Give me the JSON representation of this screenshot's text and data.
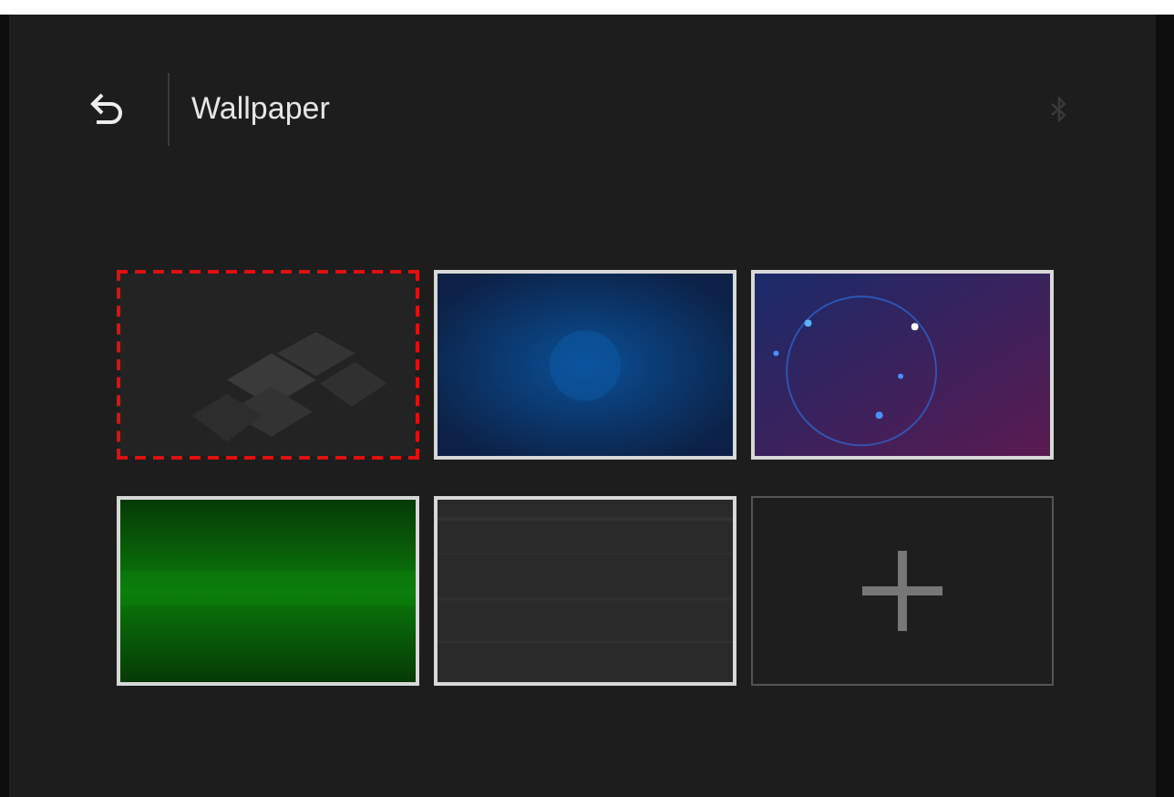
{
  "header": {
    "title": "Wallpaper"
  },
  "tiles": [
    {
      "kind": "picture",
      "selected": true
    },
    {
      "kind": "picture",
      "selected": false
    },
    {
      "kind": "picture",
      "selected": false
    },
    {
      "kind": "picture",
      "selected": false
    },
    {
      "kind": "picture",
      "selected": false
    },
    {
      "kind": "add",
      "selected": false
    }
  ]
}
